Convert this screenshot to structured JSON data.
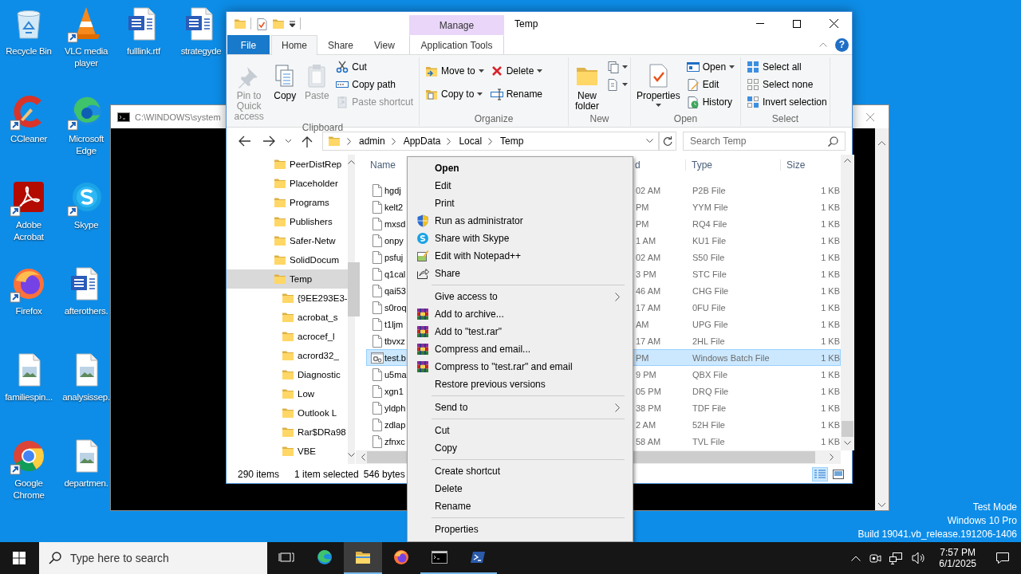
{
  "desktop": {
    "icon_rows": [
      [
        {
          "label": "Recycle Bin"
        },
        {
          "label": "VLC media player"
        },
        {
          "label": "fulllink.rtf"
        },
        {
          "label": "strategyde"
        }
      ],
      [
        {
          "label": "CCleaner"
        },
        {
          "label": "Microsoft Edge"
        }
      ],
      [
        {
          "label": "Adobe Acrobat"
        },
        {
          "label": "Skype"
        }
      ],
      [
        {
          "label": "Firefox"
        },
        {
          "label": "afterothers."
        }
      ],
      [
        {
          "label": "familiespin..."
        },
        {
          "label": "analysissep."
        }
      ],
      [
        {
          "label": "Google Chrome"
        },
        {
          "label": "departmen."
        }
      ]
    ],
    "watermark": [
      "Test Mode",
      "Windows 10 Pro",
      "Build 19041.vb_release.191206-1406"
    ]
  },
  "console_window": {
    "title": "C:\\WINDOWS\\system"
  },
  "explorer": {
    "title": "Temp",
    "context_tab": "Manage",
    "tabs": [
      {
        "label": "File",
        "kind": "file",
        "selected": false
      },
      {
        "label": "Home",
        "kind": "normal",
        "selected": true
      },
      {
        "label": "Share",
        "kind": "normal",
        "selected": false
      },
      {
        "label": "View",
        "kind": "normal",
        "selected": false
      },
      {
        "label": "Application Tools",
        "kind": "contextual",
        "selected": false
      }
    ],
    "help": "?",
    "ribbon": {
      "groups": [
        {
          "label": "Clipboard",
          "stacks": [
            [
              {
                "label": "Pin to Quick access",
                "kind": "large",
                "disabled": true,
                "menu": false
              }
            ],
            [
              {
                "label": "Copy",
                "kind": "large",
                "disabled": false,
                "menu": false
              }
            ],
            [
              {
                "label": "Paste",
                "kind": "large",
                "disabled": true,
                "menu": false
              }
            ],
            [
              {
                "label": "Cut",
                "kind": "small",
                "disabled": false,
                "menu": false
              },
              {
                "label": "Copy path",
                "kind": "small",
                "disabled": false,
                "menu": false
              },
              {
                "label": "Paste shortcut",
                "kind": "small",
                "disabled": true,
                "menu": false
              }
            ]
          ]
        },
        {
          "label": "Organize",
          "stacks": [
            [
              {
                "label": "Move to",
                "kind": "small",
                "disabled": false,
                "menu": true
              },
              {
                "label": "Copy to",
                "kind": "small",
                "disabled": false,
                "menu": true
              }
            ],
            [
              {
                "label": "Delete",
                "kind": "small",
                "disabled": false,
                "menu": true
              },
              {
                "label": "Rename",
                "kind": "small",
                "disabled": false,
                "menu": false
              }
            ]
          ]
        },
        {
          "label": "New",
          "stacks": [
            [
              {
                "label": "New folder",
                "kind": "large",
                "disabled": false,
                "menu": false
              }
            ],
            [
              {
                "kind": "icon",
                "disabled": false,
                "menu": true
              },
              {
                "kind": "icon",
                "disabled": false,
                "menu": true
              }
            ]
          ]
        },
        {
          "label": "Open",
          "stacks": [
            [
              {
                "label": "Properties",
                "kind": "large",
                "disabled": false,
                "menu": true
              }
            ],
            [
              {
                "label": "Open",
                "kind": "small",
                "disabled": false,
                "menu": true
              },
              {
                "label": "Edit",
                "kind": "small",
                "disabled": false,
                "menu": false
              },
              {
                "label": "History",
                "kind": "small",
                "disabled": false,
                "menu": false
              }
            ]
          ]
        },
        {
          "label": "Select",
          "stacks": [
            [
              {
                "label": "Select all",
                "kind": "small",
                "disabled": false,
                "menu": false
              },
              {
                "label": "Select none",
                "kind": "small",
                "disabled": false,
                "menu": false
              },
              {
                "label": "Invert selection",
                "kind": "small",
                "disabled": false,
                "menu": false
              }
            ]
          ]
        }
      ]
    },
    "address": {
      "path": [
        "admin",
        "AppData",
        "Local",
        "Temp"
      ]
    },
    "search": {
      "placeholder": "Search Temp"
    },
    "nav_pane": {
      "items": [
        {
          "label": "PeerDistRep",
          "selected": false
        },
        {
          "label": "Placeholder",
          "selected": false
        },
        {
          "label": "Programs",
          "selected": false
        },
        {
          "label": "Publishers",
          "selected": false
        },
        {
          "label": "Safer-Netw",
          "selected": false
        },
        {
          "label": "SolidDocum",
          "selected": false
        },
        {
          "label": "Temp",
          "selected": true,
          "children": [
            {
              "label": "{9EE293E3-",
              "selected": false
            },
            {
              "label": "acrobat_s",
              "selected": false
            },
            {
              "label": "acrocef_l",
              "selected": false
            },
            {
              "label": "acrord32_",
              "selected": false
            },
            {
              "label": "Diagnostic",
              "selected": false
            },
            {
              "label": "Low",
              "selected": false
            },
            {
              "label": "Outlook L",
              "selected": false
            },
            {
              "label": "Rar$DRa98",
              "selected": false
            },
            {
              "label": "VBE",
              "selected": false
            }
          ]
        }
      ]
    },
    "file_list": {
      "columns": [
        "Name",
        "d",
        "Type",
        "Size"
      ],
      "rows": [
        {
          "name": "hgdj",
          "date": "02 AM",
          "type": "P2B File",
          "size": "1 KB",
          "kind": "file",
          "selected": false
        },
        {
          "name": "kelt2",
          "date": "PM",
          "type": "YYM File",
          "size": "1 KB",
          "kind": "file",
          "selected": false
        },
        {
          "name": "mxsd",
          "date": "PM",
          "type": "RQ4 File",
          "size": "1 KB",
          "kind": "file",
          "selected": false
        },
        {
          "name": "onpy",
          "date": "1 AM",
          "type": "KU1 File",
          "size": "1 KB",
          "kind": "file",
          "selected": false
        },
        {
          "name": "psfuj",
          "date": "02 AM",
          "type": "S50 File",
          "size": "1 KB",
          "kind": "file",
          "selected": false
        },
        {
          "name": "q1cal",
          "date": "3 PM",
          "type": "STC File",
          "size": "1 KB",
          "kind": "file",
          "selected": false
        },
        {
          "name": "qai53",
          "date": "46 AM",
          "type": "CHG File",
          "size": "1 KB",
          "kind": "file",
          "selected": false
        },
        {
          "name": "s0roq",
          "date": "17 AM",
          "type": "0FU File",
          "size": "1 KB",
          "kind": "file",
          "selected": false
        },
        {
          "name": "t1ljm",
          "date": "AM",
          "type": "UPG File",
          "size": "1 KB",
          "kind": "file",
          "selected": false
        },
        {
          "name": "tbvxz",
          "date": "17 AM",
          "type": "2HL File",
          "size": "1 KB",
          "kind": "file",
          "selected": false
        },
        {
          "name": "test.b",
          "date": "PM",
          "type": "Windows Batch File",
          "size": "1 KB",
          "kind": "batch",
          "selected": true
        },
        {
          "name": "u5ma",
          "date": "9 PM",
          "type": "QBX File",
          "size": "1 KB",
          "kind": "file",
          "selected": false
        },
        {
          "name": "xgn1",
          "date": "05 PM",
          "type": "DRQ File",
          "size": "1 KB",
          "kind": "file",
          "selected": false
        },
        {
          "name": "yldph",
          "date": "38 PM",
          "type": "TDF File",
          "size": "1 KB",
          "kind": "file",
          "selected": false
        },
        {
          "name": "zdlap",
          "date": "2 AM",
          "type": "52H File",
          "size": "1 KB",
          "kind": "file",
          "selected": false
        },
        {
          "name": "zfnxc",
          "date": "58 AM",
          "type": "TVL File",
          "size": "1 KB",
          "kind": "file",
          "selected": false
        }
      ]
    },
    "status_bar": {
      "item_count": "290 items",
      "selection": "1 item selected",
      "selection_size": "546 bytes",
      "view_buttons": [
        {
          "selected": true
        },
        {
          "selected": false
        }
      ]
    }
  },
  "context_menu": {
    "items": [
      {
        "kind": "item",
        "label": "Open",
        "default": true
      },
      {
        "kind": "item",
        "label": "Edit",
        "default": false
      },
      {
        "kind": "item",
        "label": "Print",
        "default": false
      },
      {
        "kind": "item",
        "label": "Run as administrator",
        "default": false
      },
      {
        "kind": "item",
        "label": "Share with Skype",
        "default": false
      },
      {
        "kind": "item",
        "label": "Edit with Notepad++",
        "default": false
      },
      {
        "kind": "item",
        "label": "Share",
        "default": false
      },
      {
        "kind": "separator"
      },
      {
        "kind": "submenu",
        "label": "Give access to",
        "default": false
      },
      {
        "kind": "item",
        "label": "Add to archive...",
        "default": false
      },
      {
        "kind": "item",
        "label": "Add to \"test.rar\"",
        "default": false
      },
      {
        "kind": "item",
        "label": "Compress and email...",
        "default": false
      },
      {
        "kind": "item",
        "label": "Compress to \"test.rar\" and email",
        "default": false
      },
      {
        "kind": "item",
        "label": "Restore previous versions",
        "default": false
      },
      {
        "kind": "separator"
      },
      {
        "kind": "submenu",
        "label": "Send to",
        "default": false
      },
      {
        "kind": "separator"
      },
      {
        "kind": "item",
        "label": "Cut",
        "default": false
      },
      {
        "kind": "item",
        "label": "Copy",
        "default": false
      },
      {
        "kind": "separator"
      },
      {
        "kind": "item",
        "label": "Create shortcut",
        "default": false
      },
      {
        "kind": "item",
        "label": "Delete",
        "default": false
      },
      {
        "kind": "item",
        "label": "Rename",
        "default": false
      },
      {
        "kind": "separator"
      },
      {
        "kind": "item",
        "label": "Properties",
        "default": false
      }
    ]
  },
  "taskbar": {
    "search": {
      "placeholder": "Type here to search"
    },
    "apps": [
      {
        "selected": false,
        "running": false
      },
      {
        "selected": false,
        "running": false
      },
      {
        "selected": true,
        "running": true
      },
      {
        "selected": false,
        "running": false
      },
      {
        "selected": false,
        "running": true
      },
      {
        "selected": false,
        "running": true
      }
    ],
    "time": "7:57 PM",
    "date": "6/1/2025"
  }
}
